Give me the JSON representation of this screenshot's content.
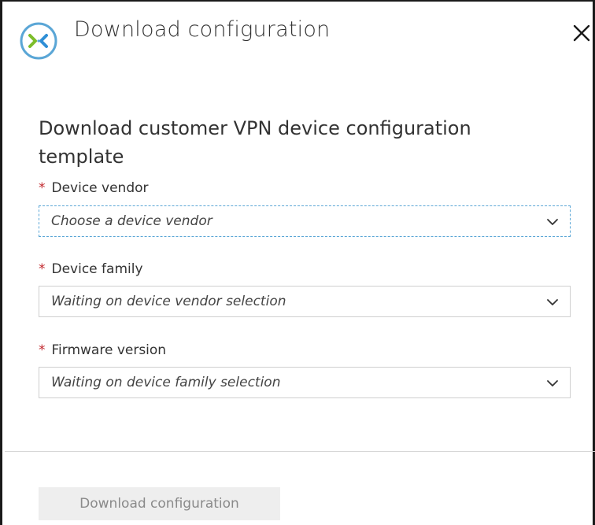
{
  "header": {
    "title": "Download configuration",
    "icon": "vpn-connection-icon",
    "close_icon": "close-icon"
  },
  "form": {
    "heading": "Download customer VPN device configuration template",
    "required_marker": "*",
    "fields": [
      {
        "label": "Device vendor",
        "value": "Choose a device vendor",
        "focused": true
      },
      {
        "label": "Device family",
        "value": "Waiting on device vendor selection",
        "focused": false
      },
      {
        "label": "Firmware version",
        "value": "Waiting on device family selection",
        "focused": false
      }
    ]
  },
  "footer": {
    "download_label": "Download configuration",
    "download_enabled": false
  },
  "colors": {
    "required": "#c1272d",
    "icon_ring": "#5aa6d6",
    "icon_arrow_green": "#7cbd2a",
    "icon_arrow_blue": "#2f8fd6",
    "focus_border": "#5aa6d6",
    "disabled_button_bg": "#eeeeee",
    "disabled_button_text": "#8a8a8a"
  }
}
